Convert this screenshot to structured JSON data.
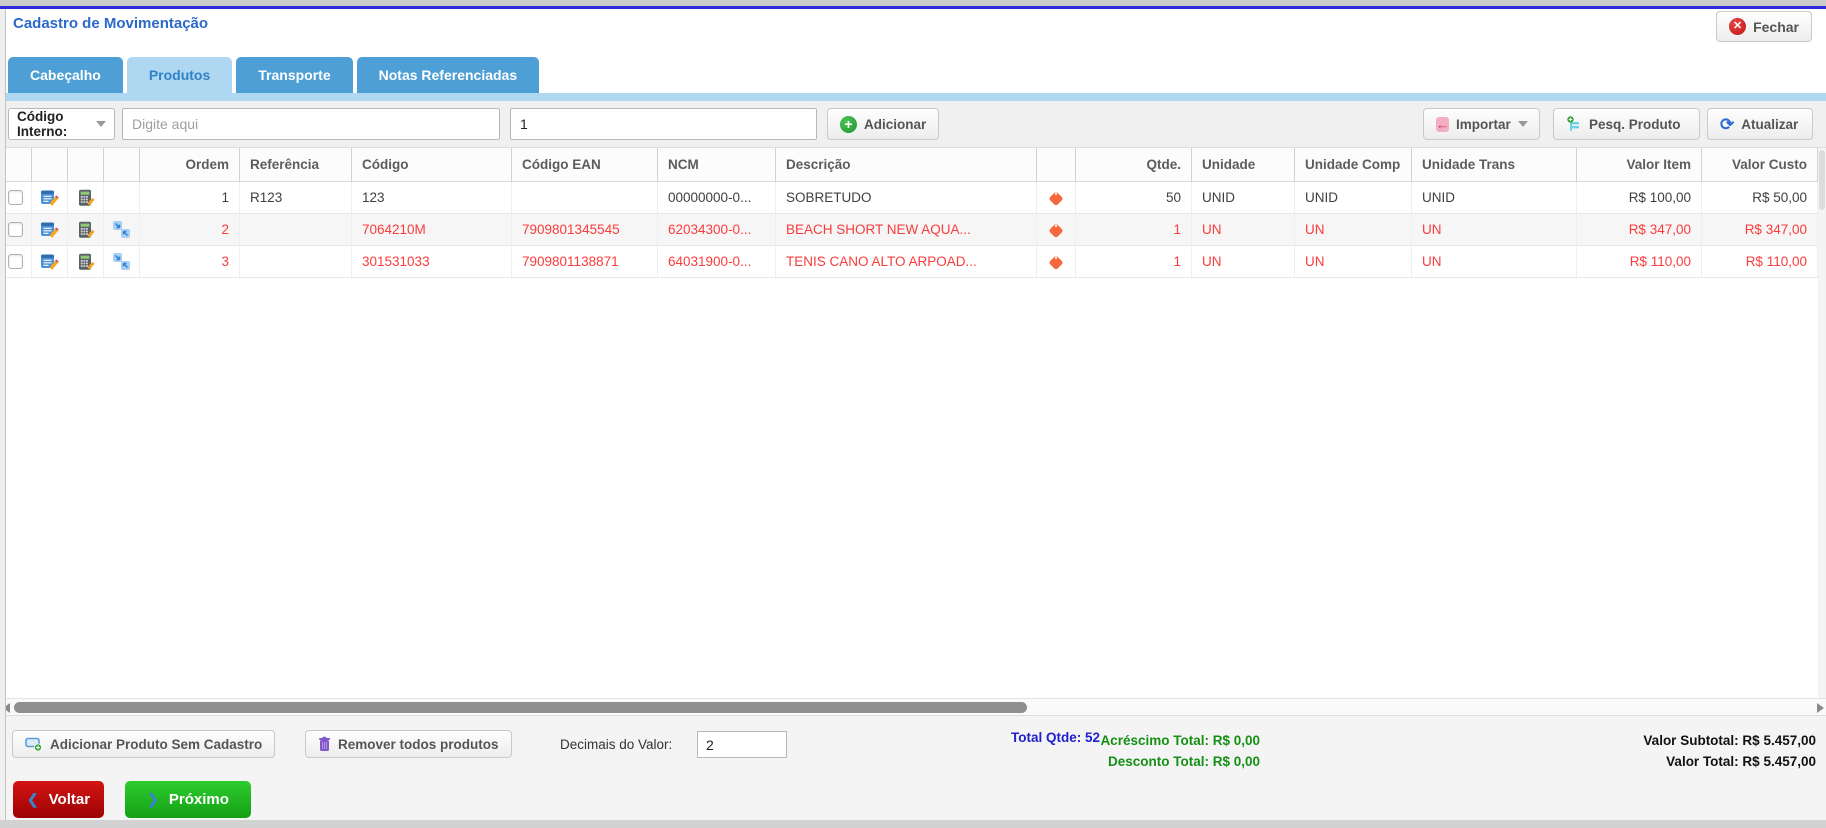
{
  "window": {
    "title": "Cadastro de Movimentação",
    "close_label": "Fechar"
  },
  "tabs": [
    {
      "label": "Cabeçalho",
      "active": false
    },
    {
      "label": "Produtos",
      "active": true
    },
    {
      "label": "Transporte",
      "active": false
    },
    {
      "label": "Notas Referenciadas",
      "active": false
    }
  ],
  "toolbar": {
    "field_selector": "Código Interno:",
    "search_placeholder": "Digite aqui",
    "qty_value": "1",
    "add_label": "Adicionar",
    "import_label": "Importar",
    "search_product_label": "Pesq. Produto",
    "refresh_label": "Atualizar"
  },
  "table": {
    "columns": [
      "Ordem",
      "Referência",
      "Código",
      "Código EAN",
      "NCM",
      "Descrição",
      "Qtde.",
      "Unidade",
      "Unidade Comp",
      "Unidade Trans",
      "Valor Item",
      "Valor Custo"
    ],
    "rows": [
      {
        "ordem": "1",
        "referencia": "R123",
        "codigo": "123",
        "ean": "",
        "ncm": "00000000-0...",
        "descricao": "SOBRETUDO",
        "qtde": "50",
        "unidade": "UNID",
        "unidade_comp": "UNID",
        "unidade_trans": "UNID",
        "valor_item": "R$ 100,00",
        "valor_custo": "R$ 50,00",
        "highlight": false,
        "has_merge_icon": false
      },
      {
        "ordem": "2",
        "referencia": "",
        "codigo": "7064210M",
        "ean": "7909801345545",
        "ncm": "62034300-0...",
        "descricao": "BEACH SHORT NEW AQUA...",
        "qtde": "1",
        "unidade": "UN",
        "unidade_comp": "UN",
        "unidade_trans": "UN",
        "valor_item": "R$ 347,00",
        "valor_custo": "R$ 347,00",
        "highlight": true,
        "has_merge_icon": true
      },
      {
        "ordem": "3",
        "referencia": "",
        "codigo": "301531033",
        "ean": "7909801138871",
        "ncm": "64031900-0...",
        "descricao": "TENIS CANO ALTO ARPOAD...",
        "qtde": "1",
        "unidade": "UN",
        "unidade_comp": "UN",
        "unidade_trans": "UN",
        "valor_item": "R$ 110,00",
        "valor_custo": "R$ 110,00",
        "highlight": true,
        "has_merge_icon": true
      }
    ]
  },
  "footer": {
    "add_unregistered_label": "Adicionar Produto Sem Cadastro",
    "remove_all_label": "Remover todos produtos",
    "decimals_label": "Decimais do Valor:",
    "decimals_value": "2",
    "total_qty": "Total Qtde: 52",
    "addition_total": "Acréscimo Total: R$ 0,00",
    "discount_total": "Desconto Total: R$ 0,00",
    "subtotal": "Valor Subtotal: R$ 5.457,00",
    "total": "Valor Total: R$ 5.457,00",
    "back_label": "Voltar",
    "next_label": "Próximo"
  },
  "colors": {
    "top_line": "#2d2dd8",
    "title_blue": "#2b6ac9",
    "accent_blue": "#4e9fd6",
    "tab_active_bg": "#b0d7f2",
    "tab_active_text": "#2d83c5",
    "row_alert": "#fb3b3b",
    "total_blue": "#2020cc",
    "total_green": "#159015",
    "tag_orange": "#f4683c",
    "back_red": "#c40f0f",
    "next_green": "#1fb01f"
  }
}
